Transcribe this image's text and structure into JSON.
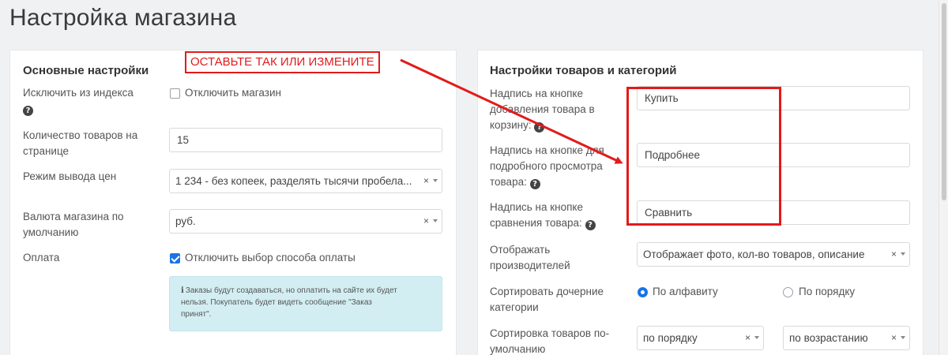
{
  "page": {
    "title": "Настройка магазина"
  },
  "annotation": {
    "text": "ОСТАВЬТЕ ТАК ИЛИ ИЗМЕНИТЕ",
    "color": "#e31a1a"
  },
  "left_panel": {
    "title": "Основные настройки",
    "exclude_index": {
      "label": "Исключить из индекса",
      "checkbox_label": "Отключить магазин",
      "checked": false
    },
    "items_per_page": {
      "label_line1": "Количество товаров на",
      "label_line2": "странице",
      "value": "15"
    },
    "price_mode": {
      "label": "Режим вывода цен",
      "value": "1 234 - без копеек, разделять тысячи пробела..."
    },
    "currency": {
      "label_line1": "Валюта магазина по",
      "label_line2": "умолчанию",
      "value": "руб."
    },
    "payment": {
      "label": "Оплата",
      "checkbox_label": "Отключить выбор способа оплаты",
      "checked": true
    },
    "info_alert": {
      "line1": "Заказы будут создаваться, но оплатить на сайте их будет",
      "line2": "нельзя. Покупатель будет видеть сообщение \"Заказ",
      "line3": "принят\"."
    }
  },
  "right_panel": {
    "title": "Настройки товаров и категорий",
    "buy_button": {
      "label_line1": "Надпись на кнопке",
      "label_line2": "добавления товара в",
      "label_line3": "корзину:",
      "value": "Купить"
    },
    "details_button": {
      "label_line1": "Надпись на кнопке для",
      "label_line2": "подробного просмотра",
      "label_line3": "товара:",
      "value": "Подробнее"
    },
    "compare_button": {
      "label_line1": "Надпись на кнопке",
      "label_line2": "сравнения товара:",
      "value": "Сравнить"
    },
    "show_manufacturers": {
      "label_line1": "Отображать",
      "label_line2": "производителей",
      "value": "Отображает фото, кол-во товаров, описание"
    },
    "sort_children": {
      "label_line1": "Сортировать дочерние",
      "label_line2": "категории",
      "option_alpha": "По алфавиту",
      "option_order": "По порядку",
      "selected": "alpha"
    },
    "default_sort": {
      "label_line1": "Сортировка товаров по-",
      "label_line2": "умолчанию",
      "field_value": "по порядку",
      "direction_value": "по возрастанию"
    }
  },
  "icons": {
    "help": "question-circle-icon",
    "info": "info-icon",
    "clear": "clear-x-icon",
    "dropdown": "chevron-down-icon"
  },
  "colors": {
    "accent": "#1a73e8",
    "annotation_red": "#e31a1a",
    "alert_bg": "#d3eef2"
  }
}
